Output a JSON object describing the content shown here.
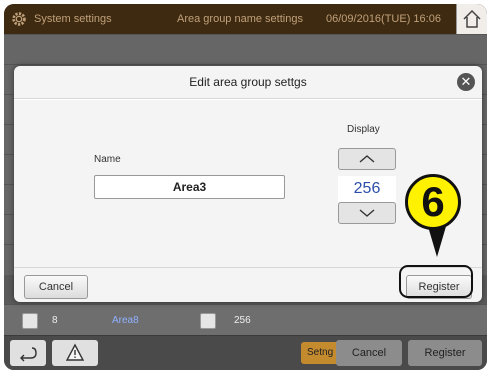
{
  "topbar": {
    "system_settings": "System settings",
    "area_group_name_settings": "Area group name settings",
    "datetime": "06/09/2016(TUE) 16:06",
    "home_icon": "home-icon",
    "gear_icon": "gear-icon"
  },
  "background_list": {
    "row_number": "8",
    "row_name": "Area8",
    "row_display": "256"
  },
  "bottombar": {
    "setng": "Setng",
    "cancel": "Cancel",
    "register": "Register",
    "back_icon": "back-arrow-icon",
    "warning_icon": "warning-icon"
  },
  "modal": {
    "title": "Edit area group settgs",
    "name_label": "Name",
    "name_value": "Area3",
    "display_label": "Display",
    "display_value": "256",
    "cancel": "Cancel",
    "register": "Register",
    "close_icon": "close-icon",
    "up_icon": "chevron-up-icon",
    "down_icon": "chevron-down-icon"
  },
  "callout": {
    "number": "6"
  },
  "colors": {
    "topbar_bg": "#3e2a10",
    "accent_yellow": "#fff200",
    "value_blue": "#2b4ea8",
    "setng_orange": "#c48a2e"
  }
}
